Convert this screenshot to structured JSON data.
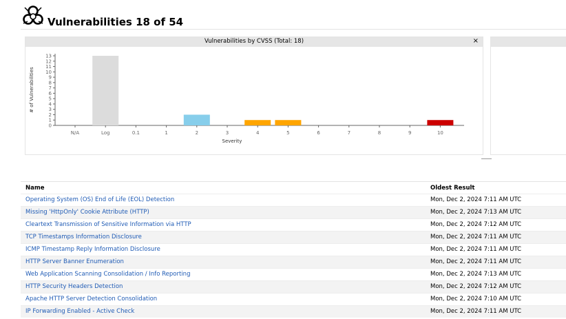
{
  "page": {
    "title": "Vulnerabilities 18 of 54"
  },
  "chart_panel": {
    "title": "Vulnerabilities by CVSS (Total: 18)",
    "close_label": "×"
  },
  "chart_data": {
    "type": "bar",
    "title": "Vulnerabilities by CVSS (Total: 18)",
    "xlabel": "Severity",
    "ylabel": "# of Vulnerabilities",
    "categories": [
      "N/A",
      "Log",
      "0.1",
      "1",
      "2",
      "3",
      "4",
      "5",
      "6",
      "7",
      "8",
      "9",
      "10"
    ],
    "values": [
      0,
      13,
      0,
      0,
      2,
      0,
      1,
      1,
      0,
      0,
      0,
      0,
      1
    ],
    "colors": [
      "#dcdcdc",
      "#dcdcdc",
      "#87ceeb",
      "#87ceeb",
      "#87ceeb",
      "#ffa500",
      "#ffa500",
      "#ffa500",
      "#ffa500",
      "#cc0000",
      "#cc0000",
      "#cc0000",
      "#cc0000"
    ],
    "yticks": [
      0,
      1,
      2,
      3,
      4,
      5,
      6,
      7,
      8,
      9,
      10,
      11,
      12,
      13
    ],
    "ylim": [
      0,
      13
    ],
    "grid": false
  },
  "table": {
    "columns": {
      "name": "Name",
      "oldest": "Oldest Result"
    },
    "rows": [
      {
        "name": "Operating System (OS) End of Life (EOL) Detection",
        "oldest": "Mon, Dec 2, 2024 7:11 AM UTC"
      },
      {
        "name": "Missing 'HttpOnly' Cookie Attribute (HTTP)",
        "oldest": "Mon, Dec 2, 2024 7:13 AM UTC"
      },
      {
        "name": "Cleartext Transmission of Sensitive Information via HTTP",
        "oldest": "Mon, Dec 2, 2024 7:12 AM UTC"
      },
      {
        "name": "TCP Timestamps Information Disclosure",
        "oldest": "Mon, Dec 2, 2024 7:11 AM UTC"
      },
      {
        "name": "ICMP Timestamp Reply Information Disclosure",
        "oldest": "Mon, Dec 2, 2024 7:11 AM UTC"
      },
      {
        "name": "HTTP Server Banner Enumeration",
        "oldest": "Mon, Dec 2, 2024 7:11 AM UTC"
      },
      {
        "name": "Web Application Scanning Consolidation / Info Reporting",
        "oldest": "Mon, Dec 2, 2024 7:13 AM UTC"
      },
      {
        "name": "HTTP Security Headers Detection",
        "oldest": "Mon, Dec 2, 2024 7:12 AM UTC"
      },
      {
        "name": "Apache HTTP Server Detection Consolidation",
        "oldest": "Mon, Dec 2, 2024 7:10 AM UTC"
      },
      {
        "name": "IP Forwarding Enabled - Active Check",
        "oldest": "Mon, Dec 2, 2024 7:11 AM UTC"
      }
    ]
  }
}
